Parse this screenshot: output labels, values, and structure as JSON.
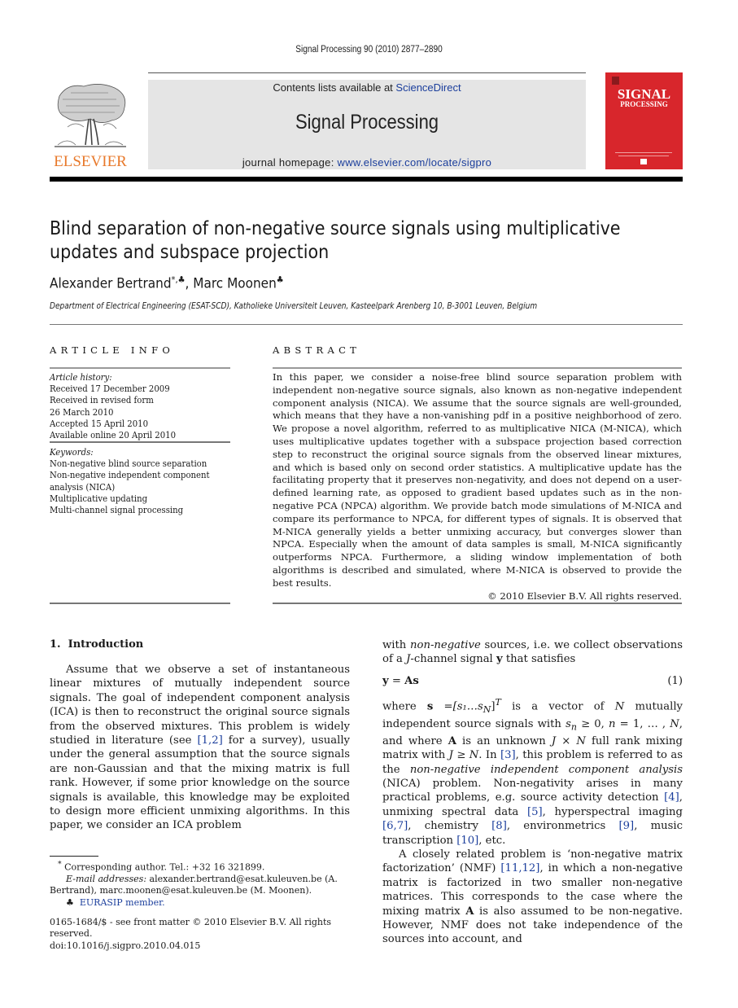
{
  "header": {
    "running_head": "Signal Processing 90 (2010) 2877–2890",
    "contents_prefix": "Contents lists available at ",
    "contents_link": "ScienceDirect",
    "journal_title": "Signal Processing",
    "homepage_prefix": "journal homepage: ",
    "homepage_link": "www.elsevier.com/locate/sigpro",
    "publisher_logo_text": "ELSEVIER",
    "cover_title_1": "SIGNAL",
    "cover_title_2": "PROCESSING",
    "colors": {
      "publisher_orange": "#e8792b",
      "cover_red": "#d8262c",
      "link_blue": "#1b3e9c",
      "banner_gray": "#e5e5e5"
    }
  },
  "article": {
    "title": "Blind separation of non-negative source signals using multiplicative updates and subspace projection",
    "authors": [
      {
        "name": "Alexander Bertrand",
        "marks": "*,♣"
      },
      {
        "name": "Marc Moonen",
        "marks": "♣"
      }
    ],
    "author_separator": ", ",
    "affiliation": "Department of Electrical Engineering (ESAT-SCD), Katholieke Universiteit Leuven, Kasteelpark Arenberg 10, B-3001 Leuven, Belgium"
  },
  "article_info": {
    "heading": "ARTICLE INFO",
    "history_label": "Article history:",
    "history": [
      "Received 17 December 2009",
      "Received in revised form",
      "26 March 2010",
      "Accepted 15 April 2010",
      "Available online 20 April 2010"
    ],
    "keywords_label": "Keywords:",
    "keywords": [
      "Non-negative blind source separation",
      "Non-negative independent component",
      "analysis (NICA)",
      "Multiplicative updating",
      "Multi-channel signal processing"
    ]
  },
  "abstract": {
    "heading": "ABSTRACT",
    "text": "In this paper, we consider a noise-free blind source separation problem with independent non-negative source signals, also known as non-negative independent component analysis (NICA). We assume that the source signals are well-grounded, which means that they have a non-vanishing pdf in a positive neighborhood of zero. We propose a novel algorithm, referred to as multiplicative NICA (M-NICA), which uses multiplicative updates together with a subspace projection based correction step to reconstruct the original source signals from the observed linear mixtures, and which is based only on second order statistics. A multiplicative update has the facilitating property that it preserves non-negativity, and does not depend on a user-defined learning rate, as opposed to gradient based updates such as in the non-negative PCA (NPCA) algorithm. We provide batch mode simulations of M-NICA and compare its performance to NPCA, for different types of signals. It is observed that M-NICA generally yields a better unmixing accuracy, but converges slower than NPCA. Especially when the amount of data samples is small, M-NICA significantly outperforms NPCA. Furthermore, a sliding window implementation of both algorithms is described and simulated, where M-NICA is observed to provide the best results.",
    "copyright": "© 2010 Elsevier B.V. All rights reserved."
  },
  "body": {
    "section_number": "1.",
    "section_title": "Introduction",
    "left_col": {
      "p1_a": "Assume that we observe a set of instantaneous linear mixtures of mutually independent source signals. The goal of independent component analysis (ICA) is then to reconstruct the original source signals from the observed mixtures. This problem is widely studied in literature (see ",
      "p1_ref": "[1,2]",
      "p1_b": " for a survey), usually under the general assumption that the source signals are non-Gaussian and that the mixing matrix is full rank. However, if some prior knowledge on the source signals is available, this knowledge may be exploited to design more efficient unmixing algorithms. In this paper, we consider an ICA problem"
    },
    "right_col": {
      "p0_a": "with ",
      "p0_em": "non-negative",
      "p0_b": " sources, i.e. we collect observations of a ",
      "p0_J": "J",
      "p0_c": "-channel signal ",
      "p0_y": "y",
      "p0_d": " that satisfies",
      "eq_lhs": "y",
      "eq_mid": " = ",
      "eq_rhs": "As",
      "eq_number": "(1)",
      "p1_a": "where ",
      "p1_s": "s",
      "p1_vec": " =[s₁…s",
      "p1_vecN": "N",
      "p1_vecT": "]",
      "p1_T": "T",
      "p1_b": " is a vector of ",
      "p1_N": "N",
      "p1_c": " mutually independent source signals with ",
      "p1_sn": "s",
      "p1_sn_sub": "n",
      "p1_d": " ≥ 0, ",
      "p1_n": "n",
      "p1_e": " = 1, … , ",
      "p1_N2": "N",
      "p1_f": ", and where ",
      "p1_A": "A",
      "p1_g": " is an unknown ",
      "p1_JxN": "J × N",
      "p1_h": " full rank mixing matrix with ",
      "p1_JgeN": "J ≥ N",
      "p1_i": ". In ",
      "ref3": "[3]",
      "p1_j": ", this problem is referred to as the ",
      "p1_em": "non-negative independent component analysis",
      "p1_k": " (NICA) problem. Non-negativity arises in many practical problems, e.g. source activity detection ",
      "ref4": "[4]",
      "p1_l": ", unmixing spectral data ",
      "ref5": "[5]",
      "p1_m": ", hyperspectral imaging ",
      "ref67": "[6,7]",
      "p1_n2": ", chemistry ",
      "ref8": "[8]",
      "p1_o": ", environmetrics ",
      "ref9": "[9]",
      "p1_p": ", music transcription ",
      "ref10": "[10]",
      "p1_q": ", etc.",
      "p2_a": "A closely related problem is ‘non-negative matrix factorization’ (NMF) ",
      "ref1112": "[11,12]",
      "p2_b": ", in which a non-negative matrix is factorized in two smaller non-negative matrices. This corresponds to the case where the mixing matrix ",
      "p2_A": "A",
      "p2_c": " is also assumed to be non-negative. However, NMF does not take independence of the sources into account, and"
    }
  },
  "footnotes": {
    "corresponding_mark": "*",
    "corresponding": " Corresponding author. Tel.: +32 16 321899.",
    "email_label": "E-mail addresses:",
    "email_text": " alexander.bertrand@esat.kuleuven.be (A. Bertrand), marc.moonen@esat.kuleuven.be (M. Moonen).",
    "club_mark": "♣",
    "eurasip": "EURASIP member.",
    "front_matter": "0165-1684/$ - see front matter © 2010 Elsevier B.V. All rights reserved.",
    "doi": "doi:10.1016/j.sigpro.2010.04.015"
  }
}
